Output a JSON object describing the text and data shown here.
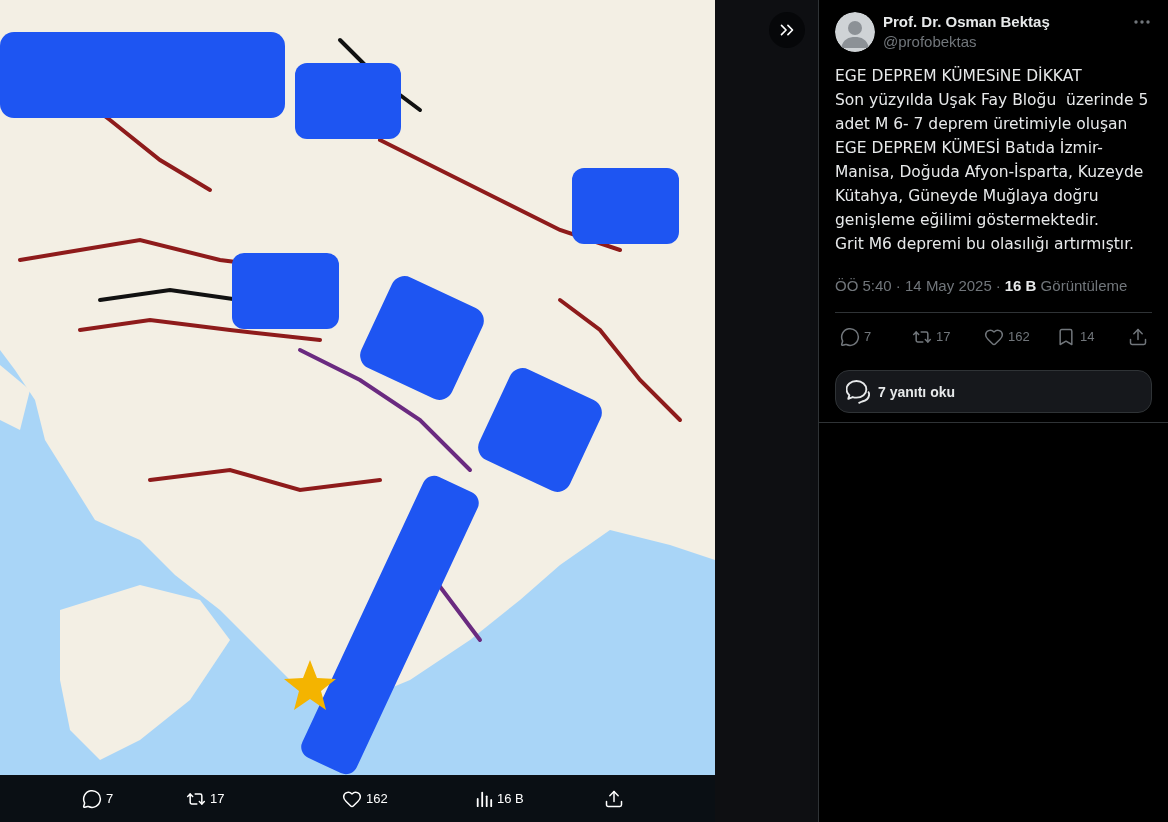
{
  "media_actions": [
    {
      "kind": "reply",
      "count": "7"
    },
    {
      "kind": "repost",
      "count": "17"
    },
    {
      "kind": "like",
      "count": "162"
    },
    {
      "kind": "views",
      "count": "16 B"
    },
    {
      "kind": "share"
    }
  ],
  "tweet": {
    "author": {
      "name": "Prof. Dr. Osman Bektaş",
      "handle": "@profobektas"
    },
    "text": "EGE DEPREM KÜMESiNE DİKKAT\nSon yüzyılda Uşak Fay Bloğu  üzerinde 5 adet M 6- 7 deprem üretimiyle oluşan EGE DEPREM KÜMESİ Batıda İzmir-Manisa, Doğuda Afyon-İsparta, Kuzeyde Kütahya, Güneyde Muğlaya doğru genişleme eğilimi göstermektedir.\nGrit M6 depremi bu olasılığı artırmıştır.",
    "meta": {
      "time": "ÖÖ 5:40 · 14 May 2025",
      "separator": "·",
      "views": "**16 B** Görüntüleme"
    },
    "actions": [
      {
        "kind": "reply",
        "count": "7"
      },
      {
        "kind": "repost",
        "count": "17"
      },
      {
        "kind": "like",
        "count": "162"
      },
      {
        "kind": "bookmark",
        "count": "14"
      },
      {
        "kind": "share"
      }
    ],
    "read_replies": {
      "label": "7 yanıtı oku"
    }
  }
}
